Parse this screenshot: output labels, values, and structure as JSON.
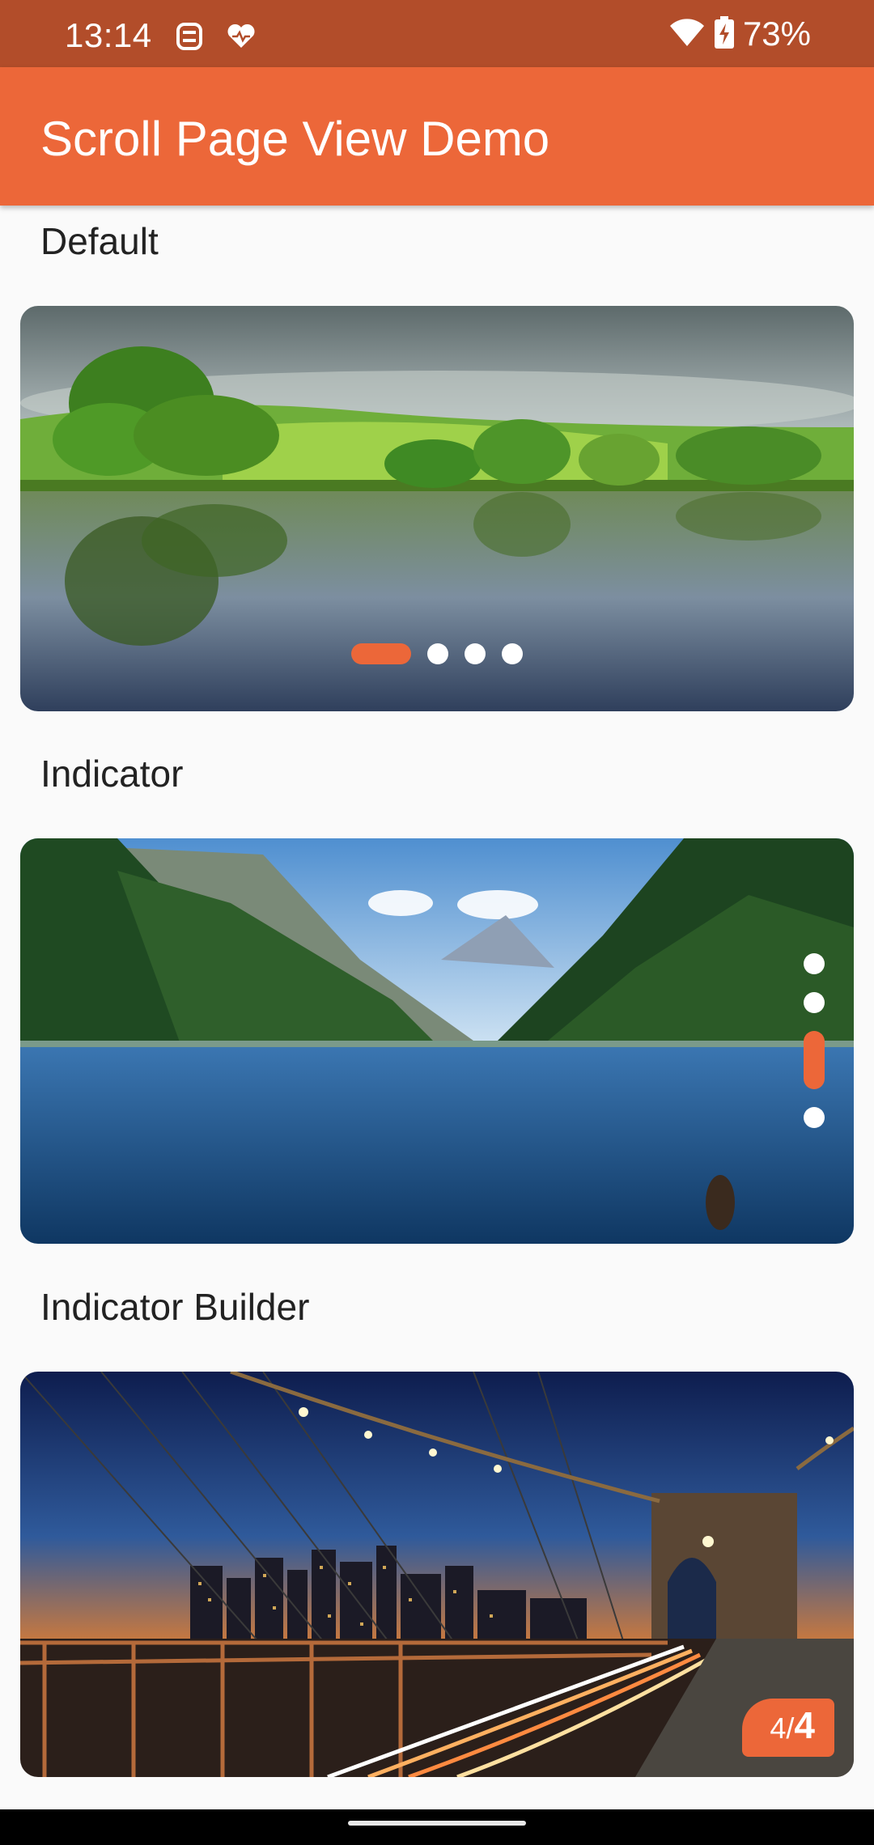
{
  "status_bar": {
    "time": "13:14",
    "battery_percent": "73%",
    "icons": [
      "assistant-icon",
      "health-icon",
      "wifi-icon",
      "battery-charging-icon"
    ]
  },
  "app_bar": {
    "title": "Scroll Page View Demo",
    "color": "#EC6739"
  },
  "sections": [
    {
      "title": "Default",
      "image": "lake-reflection-meadow",
      "indicator": {
        "style": "horizontal-dots",
        "count": 4,
        "active_index": 0
      }
    },
    {
      "title": "Indicator",
      "image": "mountain-lake",
      "indicator": {
        "style": "vertical-dots",
        "count": 4,
        "active_index": 2
      }
    },
    {
      "title": "Indicator Builder",
      "image": "city-bridge-night",
      "indicator": {
        "style": "page-counter",
        "current": "4",
        "total": "4",
        "separator": "/"
      }
    }
  ],
  "colors": {
    "accent": "#EC6739",
    "status_bar": "#B24D2A",
    "background": "#FAFAFA"
  }
}
